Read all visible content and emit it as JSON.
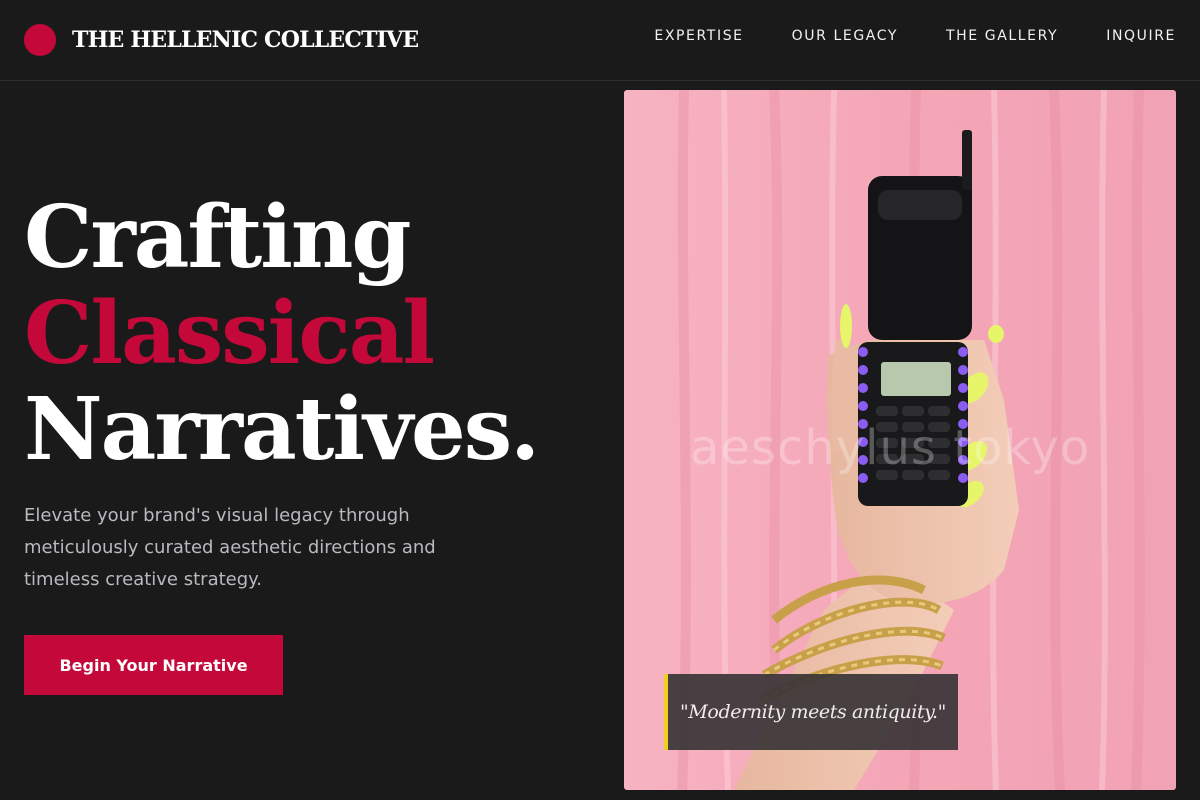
{
  "colors": {
    "accent": "#c4093a",
    "background": "#1a1a1a",
    "quote_border": "#f2cf1c",
    "photo_background": "#f4a9b9"
  },
  "header": {
    "logo_icon": "red-circle-logo",
    "brand": "THE HELLENIC COLLECTIVE",
    "nav": [
      "EXPERTISE",
      "OUR LEGACY",
      "THE GALLERY",
      "INQUIRE"
    ]
  },
  "hero": {
    "headline": {
      "line1": "Crafting",
      "line2": "Classical",
      "line3": "Narratives."
    },
    "subtitle": "Elevate your brand's visual legacy through meticulously curated aesthetic directions and timeless creative strategy.",
    "cta_label": "Begin Your Narrative"
  },
  "photo": {
    "watermark": "aeschylus tokyo",
    "quote": "\"Modernity meets antiquity.\""
  }
}
